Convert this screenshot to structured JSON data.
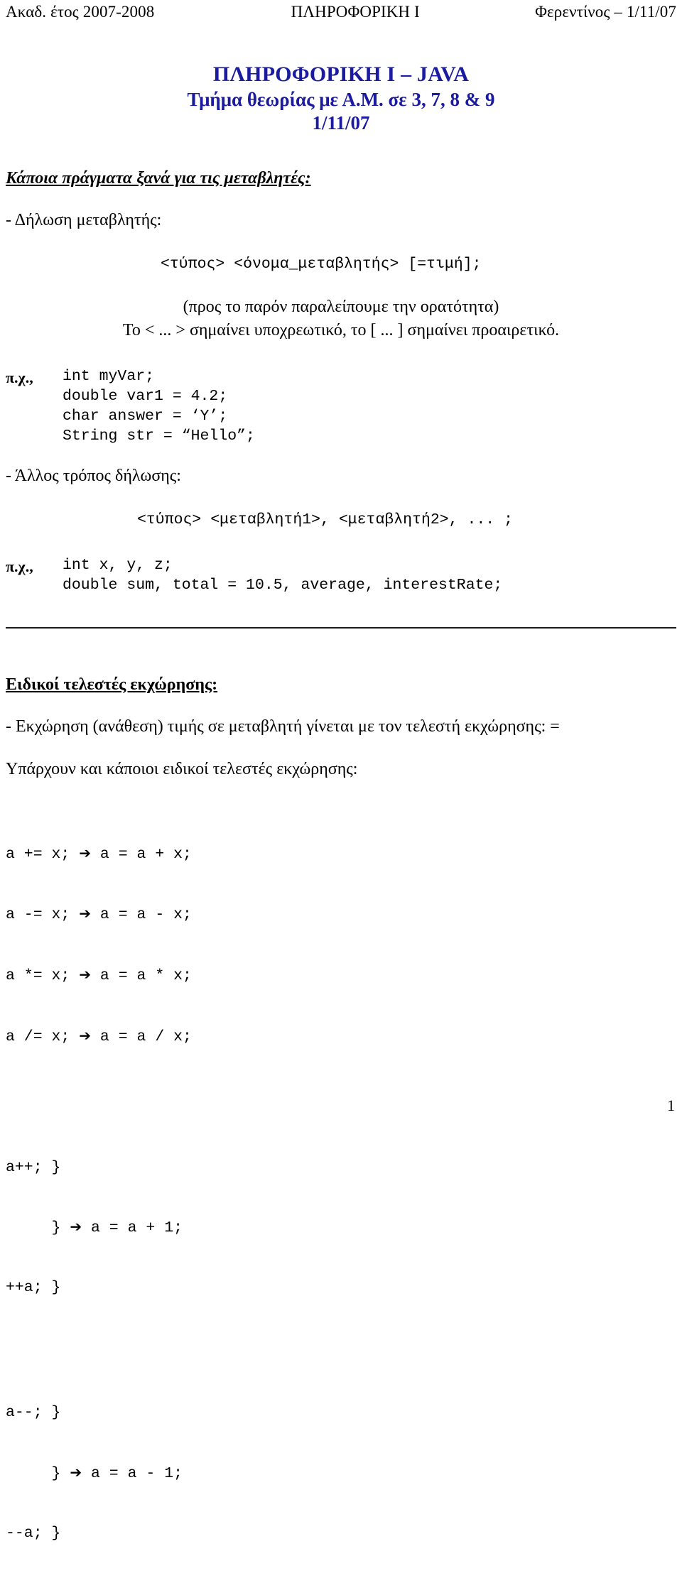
{
  "header": {
    "left": "Ακαδ. έτος 2007-2008",
    "center": "ΠΛΗΡΟΦΟΡΙΚΗ Ι",
    "right": "Φερεντίνος – 1/11/07"
  },
  "title": {
    "line1": "ΠΛΗΡΟΦΟΡΙΚΗ Ι – JAVA",
    "line2": "Τμήμα θεωρίας με Α.Μ. σε 3, 7, 8 & 9",
    "line3": "1/11/07",
    "color": "#1b1ba0"
  },
  "section_variables": {
    "heading": "Κάποια πράγματα ξανά για τις μεταβλητές:",
    "bullet_declaration": "- Δήλωση μεταβλητής:",
    "syntax_declaration": "<τύπος> <όνομα_μεταβλητής> [=τιμή];",
    "note_visibility": "(προς το παρόν παραλείπουμε την ορατότητα)",
    "note_brackets": "Το < ... > σημαίνει υποχρεωτικό, το [ ... ] σημαίνει προαιρετικό.",
    "example_label": "π.χ.,",
    "example_code_1": "int myVar;\ndouble var1 = 4.2;\nchar answer = ‘Y’;\nString str = “Hello”;",
    "bullet_other_way": "- Άλλος τρόπος δήλωσης:",
    "syntax_multi": "<τύπος> <μεταβλητή1>, <μεταβλητή2>, ... ;",
    "example_label_2": "π.χ.,",
    "example_code_2": "int x, y, z;\ndouble sum, total = 10.5, average, interestRate;"
  },
  "section_operators": {
    "heading": "Ειδικοί τελεστές εκχώρησης:",
    "bullet_assignment": "- Εκχώρηση (ανάθεση) τιμής σε μεταβλητή γίνεται με τον τελεστή εκχώρησης:  =",
    "intro_special": "Υπάρχουν και κάποιοι ειδικοί τελεστές εκχώρησης:",
    "compound_ops": [
      {
        "left": "a += x;",
        "arrow": "➔",
        "right": "a = a + x;"
      },
      {
        "left": "a -= x;",
        "arrow": "➔",
        "right": "a = a - x;"
      },
      {
        "left": "a *= x;",
        "arrow": "➔",
        "right": "a = a * x;"
      },
      {
        "left": "a /= x;",
        "arrow": "➔",
        "right": "a = a / x;"
      }
    ],
    "increment_block": {
      "line1": "a++; }",
      "line2_brace": "     } ",
      "line2_arrow": "➔",
      "line2_result": " a = a + 1;",
      "line3": "++a; }"
    },
    "decrement_block": {
      "line1": "a--; }",
      "line2_brace": "     } ",
      "line2_arrow": "➔",
      "line2_result": " a = a - 1;",
      "line3": "--a; }"
    }
  },
  "footer": {
    "page_number": "1"
  }
}
